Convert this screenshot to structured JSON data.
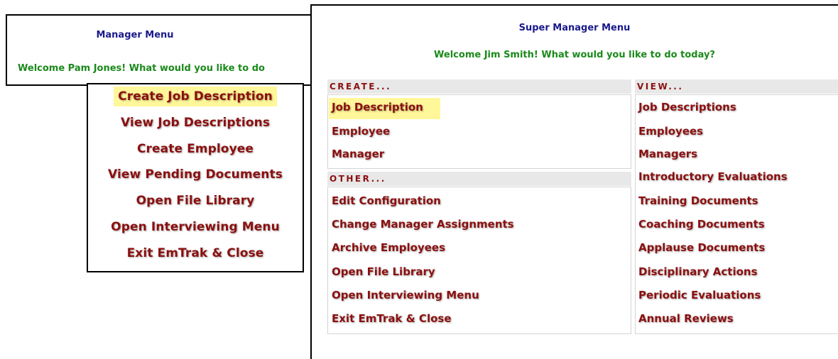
{
  "manager": {
    "title": "Manager Menu",
    "welcome": "Welcome Pam Jones! What would you like to do",
    "menu": [
      "Create Job Description",
      "View Job Descriptions",
      "Create Employee",
      "View Pending Documents",
      "Open File Library",
      "Open Interviewing Menu",
      "Exit EmTrak & Close"
    ],
    "highlight_color": "#fff79a"
  },
  "super_manager": {
    "title": "Super Manager Menu",
    "welcome": "Welcome Jim Smith! What would you like to do today?",
    "create": {
      "header": "CREATE...",
      "items": [
        "Job Description",
        "Employee",
        "Manager"
      ]
    },
    "other": {
      "header": "OTHER...",
      "items": [
        "Edit Configuration",
        "Change Manager Assignments",
        "Archive Employees",
        "Open File Library",
        "Open Interviewing Menu",
        "Exit EmTrak & Close"
      ]
    },
    "view": {
      "header": "VIEW...",
      "items": [
        "Job Descriptions",
        "Employees",
        "Managers",
        "Introductory Evaluations",
        "Training Documents",
        "Coaching Documents",
        "Applause Documents",
        "Disciplinary Actions",
        "Periodic Evaluations",
        "Annual Reviews"
      ]
    }
  },
  "colors": {
    "title": "#1a1a8c",
    "welcome": "#1a8a1a",
    "menu_link": "#8b1010",
    "section_bg": "#e8e8e8"
  }
}
